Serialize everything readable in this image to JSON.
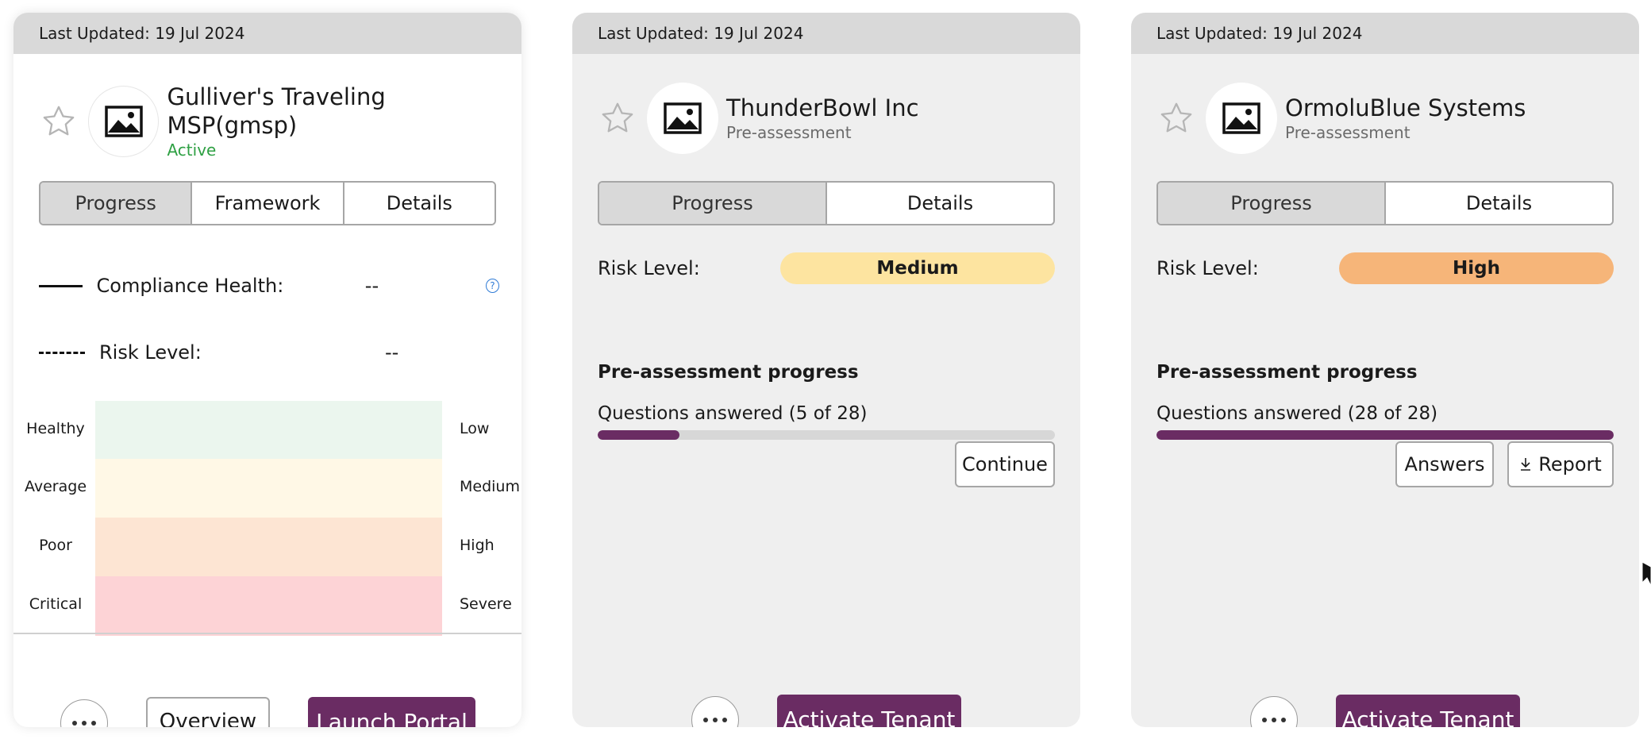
{
  "colors": {
    "primary": "#6a2c63",
    "active_status": "#2ea043",
    "risk_medium": "#fde4a0",
    "risk_high": "#f6b579",
    "band_healthy": "#ebf6ee",
    "band_average": "#fff8e6",
    "band_poor": "#fde5d3",
    "band_critical": "#fdd3d6"
  },
  "cards": [
    {
      "last_updated": "Last Updated: 19 Jul 2024",
      "name": "Gulliver's Traveling MSP(gmsp)",
      "status": "Active",
      "tabs": [
        "Progress",
        "Framework",
        "Details"
      ],
      "selected_tab": "Progress",
      "compliance_health_label": "Compliance Health:",
      "compliance_health_value": "--",
      "help_icon": "question-circle-icon",
      "risk_level_label": "Risk Level:",
      "risk_level_value": "--",
      "bands_left": [
        "Healthy",
        "Average",
        "Poor",
        "Critical"
      ],
      "bands_right": [
        "Low",
        "Medium",
        "High",
        "Severe"
      ],
      "buttons": {
        "more": "more-options-icon",
        "overview": "Overview",
        "primary": "Launch Portal"
      }
    },
    {
      "last_updated": "Last Updated: 19 Jul 2024",
      "name": "ThunderBowl Inc",
      "status": "Pre-assessment",
      "tabs": [
        "Progress",
        "Details"
      ],
      "selected_tab": "Progress",
      "risk_level_label": "Risk Level:",
      "risk_level_value": "Medium",
      "preassessment_title": "Pre-assessment progress",
      "questions_text": "Questions answered (5 of 28)",
      "questions_answered": 5,
      "questions_total": 28,
      "buttons": {
        "more": "more-options-icon",
        "continue": "Continue",
        "primary": "Activate Tenant"
      }
    },
    {
      "last_updated": "Last Updated: 19 Jul 2024",
      "name": "OrmoluBlue Systems",
      "status": "Pre-assessment",
      "tabs": [
        "Progress",
        "Details"
      ],
      "selected_tab": "Progress",
      "risk_level_label": "Risk Level:",
      "risk_level_value": "High",
      "preassessment_title": "Pre-assessment progress",
      "questions_text": "Questions answered (28 of 28)",
      "questions_answered": 28,
      "questions_total": 28,
      "buttons": {
        "more": "more-options-icon",
        "answers": "Answers",
        "report": "Report",
        "primary": "Activate Tenant"
      }
    }
  ]
}
